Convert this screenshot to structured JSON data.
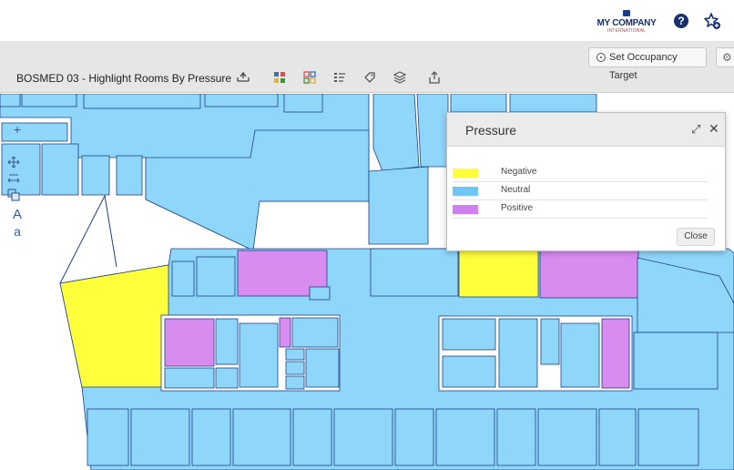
{
  "header": {
    "logo_main": "MY COMPANY",
    "logo_sub": "INTERNATIONAL",
    "help_label": "?",
    "icons": [
      "help-icon",
      "favorite-star-icon"
    ]
  },
  "toolbar": {
    "occupancy_target_label": "Set Occupancy Target",
    "settings_label": "⚙",
    "view_title": "BOSMED 03 - Highlight Rooms By Pressure",
    "tools": [
      "scale-icon",
      "color-grid-icon",
      "color-grid-outline-icon",
      "legend-list-icon",
      "tag-icon",
      "layers-icon",
      "share-icon"
    ]
  },
  "map_tools": {
    "zoom_in": "+",
    "text_large": "A",
    "text_small": "a",
    "icons": [
      "zoom-in-icon",
      "pan-icon",
      "measure-icon",
      "select-icon",
      "text-large-icon",
      "text-small-icon"
    ]
  },
  "legend": {
    "title": "Pressure",
    "items": [
      {
        "label": "Negative",
        "color": "#ffff3c"
      },
      {
        "label": "Neutral",
        "color": "#6ec6f4"
      },
      {
        "label": "Positive",
        "color": "#d080f0"
      }
    ],
    "close_label": "Close",
    "icons": [
      "expand-icon",
      "close-icon"
    ]
  },
  "colors": {
    "negative": "#ffff3c",
    "neutral": "#8fd6fb",
    "positive": "#d88cf0",
    "wall": "#1f3f86",
    "brand": "#17306d"
  }
}
